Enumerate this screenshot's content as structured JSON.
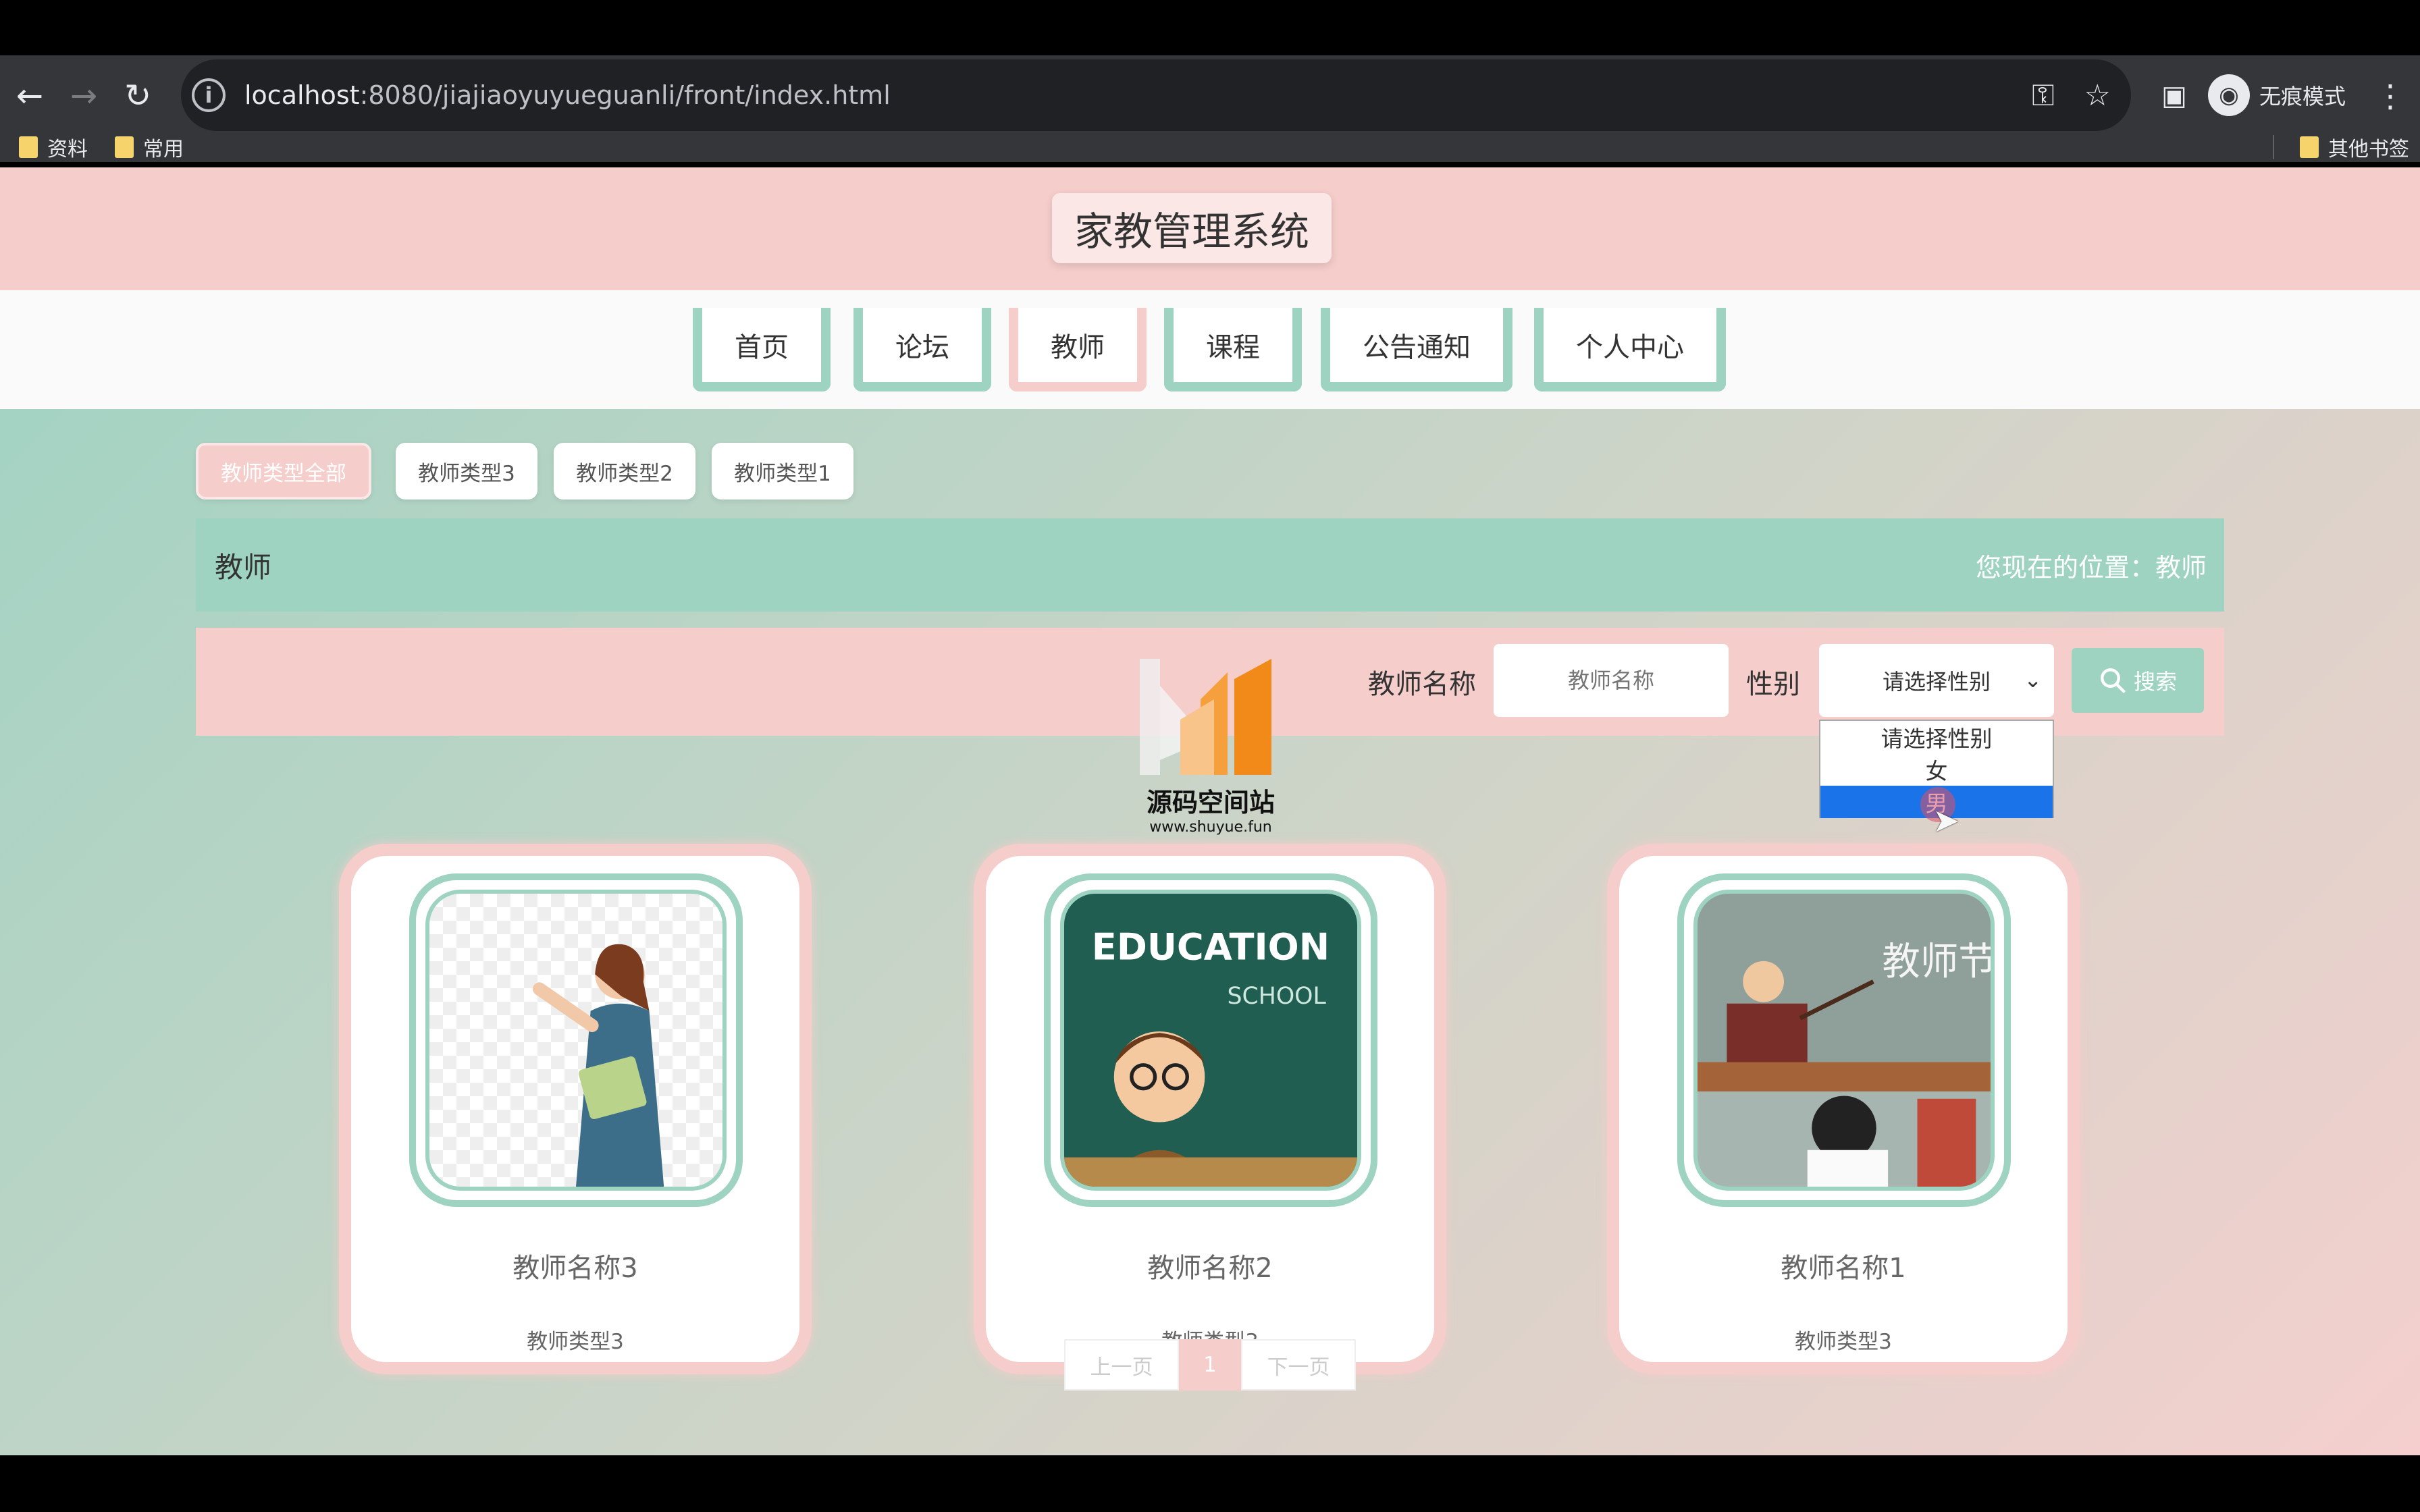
{
  "browser": {
    "url_host": "localhost",
    "url_rest": ":8080/jiajiaoyuyueguanli/front/index.html",
    "incognito_label": "无痕模式",
    "bookmarks": [
      "资料",
      "常用"
    ],
    "other_bookmarks": "其他书签"
  },
  "site": {
    "title": "家教管理系统",
    "nav": [
      "首页",
      "论坛",
      "教师",
      "课程",
      "公告通知",
      "个人中心"
    ]
  },
  "filters": [
    "教师类型全部",
    "教师类型3",
    "教师类型2",
    "教师类型1"
  ],
  "section": {
    "title": "教师",
    "crumb": "您现在的位置：教师"
  },
  "search": {
    "name_label": "教师名称",
    "name_placeholder": "教师名称",
    "gender_label": "性别",
    "gender_value": "请选择性别",
    "gender_options": [
      "请选择性别",
      "女",
      "男"
    ],
    "button_label": "搜索"
  },
  "cards": [
    {
      "name": "教师名称3",
      "type": "教师类型3"
    },
    {
      "name": "教师名称2",
      "type": "教师类型3"
    },
    {
      "name": "教师名称1",
      "type": "教师类型3"
    }
  ],
  "card_images": {
    "education_text": "EDUCATION",
    "school_text": "SCHOOL",
    "teacher_day_text": "教师节"
  },
  "pager": {
    "prev": "上一页",
    "current": "1",
    "next": "下一页"
  },
  "watermark": {
    "title": "源码空间站",
    "url": "www.shuyue.fun"
  },
  "colors": {
    "mint": "#9ed3c2",
    "pink": "#f5cdca",
    "select_highlight": "#1a73e8"
  }
}
